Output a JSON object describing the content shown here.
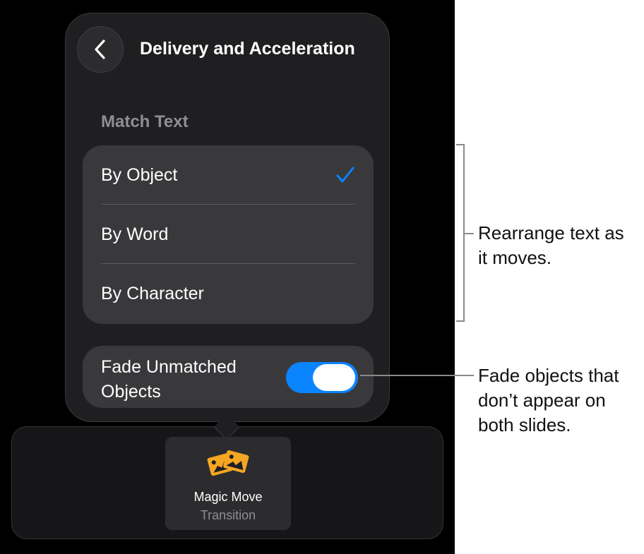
{
  "popover": {
    "title": "Delivery and Acceleration",
    "back_icon": "chevron-left-icon",
    "section_label": "Match Text",
    "options": [
      {
        "label": "By Object",
        "selected": true
      },
      {
        "label": "By Word",
        "selected": false
      },
      {
        "label": "By Character",
        "selected": false
      }
    ],
    "checkmark_color": "#0a84ff",
    "fade_toggle": {
      "label": "Fade Unmatched Objects",
      "on": true,
      "color": "#0a84ff"
    }
  },
  "transition": {
    "name": "Magic Move",
    "subtitle": "Transition",
    "icon": "magic-move-icon",
    "icon_color": "#f5a623"
  },
  "callouts": {
    "match_text": "Rearrange text as it moves.",
    "fade": "Fade objects that don’t appear on both slides."
  }
}
